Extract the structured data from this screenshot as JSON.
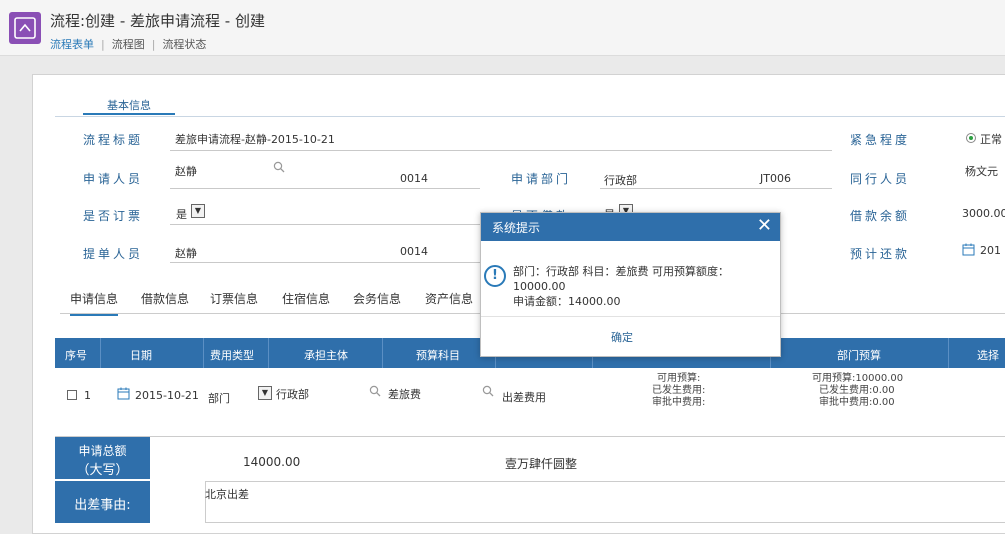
{
  "header": {
    "title": "流程:创建 - 差旅申请流程 - 创建",
    "nav": {
      "form": "流程表单",
      "sep": "|",
      "graph": "流程图",
      "status": "流程状态"
    }
  },
  "section_tab": "基本信息",
  "form": {
    "flow_title_label": "流程标题",
    "flow_title_value": "差旅申请流程-赵静-2015-10-21",
    "urgency_label": "紧急程度",
    "urgency_value": "正常",
    "applicant_label": "申请人员",
    "applicant_value": "赵静",
    "applicant_code": "0014",
    "dept_label": "申请部门",
    "dept_value": "行政部",
    "dept_code": "JT006",
    "companion_label": "同行人员",
    "companion_value": "杨文元",
    "ticket_label": "是否订票",
    "ticket_value": "是",
    "loan_label": "是否借款",
    "loan_value": "是",
    "loan_balance_label": "借款余额",
    "loan_balance_value": "3000.00",
    "submitter_label": "提单人员",
    "submitter_value": "赵静",
    "submitter_code": "0014",
    "repay_label": "预计还款",
    "repay_value": "201"
  },
  "tabs": [
    "申请信息",
    "借款信息",
    "订票信息",
    "住宿信息",
    "会务信息",
    "资产信息"
  ],
  "table": {
    "headers": [
      "序号",
      "日期",
      "费用类型",
      "承担主体",
      "预算科目",
      "部门预算",
      "选择"
    ],
    "row": {
      "index": "1",
      "date": "2015-10-21",
      "cost_type": "部门",
      "bearer": "行政部",
      "subject": "差旅费",
      "category": "出差费用",
      "avail": "可用预算:",
      "spent": "已发生费用:",
      "pending": "审批中费用:",
      "dept_avail": "可用预算:10000.00",
      "dept_spent": "已发生费用:0.00",
      "dept_pending": "审批中费用:0.00"
    }
  },
  "summary": {
    "total_label_1": "申请总额",
    "total_label_2": "（大写）",
    "total_value": "14000.00",
    "total_caps": "壹万肆仟圆整",
    "reason_label": "出差事由:",
    "reason_value": "北京出差"
  },
  "dialog": {
    "title": "系统提示",
    "close": "✕",
    "icon": "!",
    "line1": "部门：行政部 科目：差旅费 可用预算额度：10000.00",
    "line2": "申请金额：14000.00",
    "ok": "确定"
  },
  "colors": {
    "accent": "#2f6fab",
    "brand": "#8a4fb5"
  }
}
